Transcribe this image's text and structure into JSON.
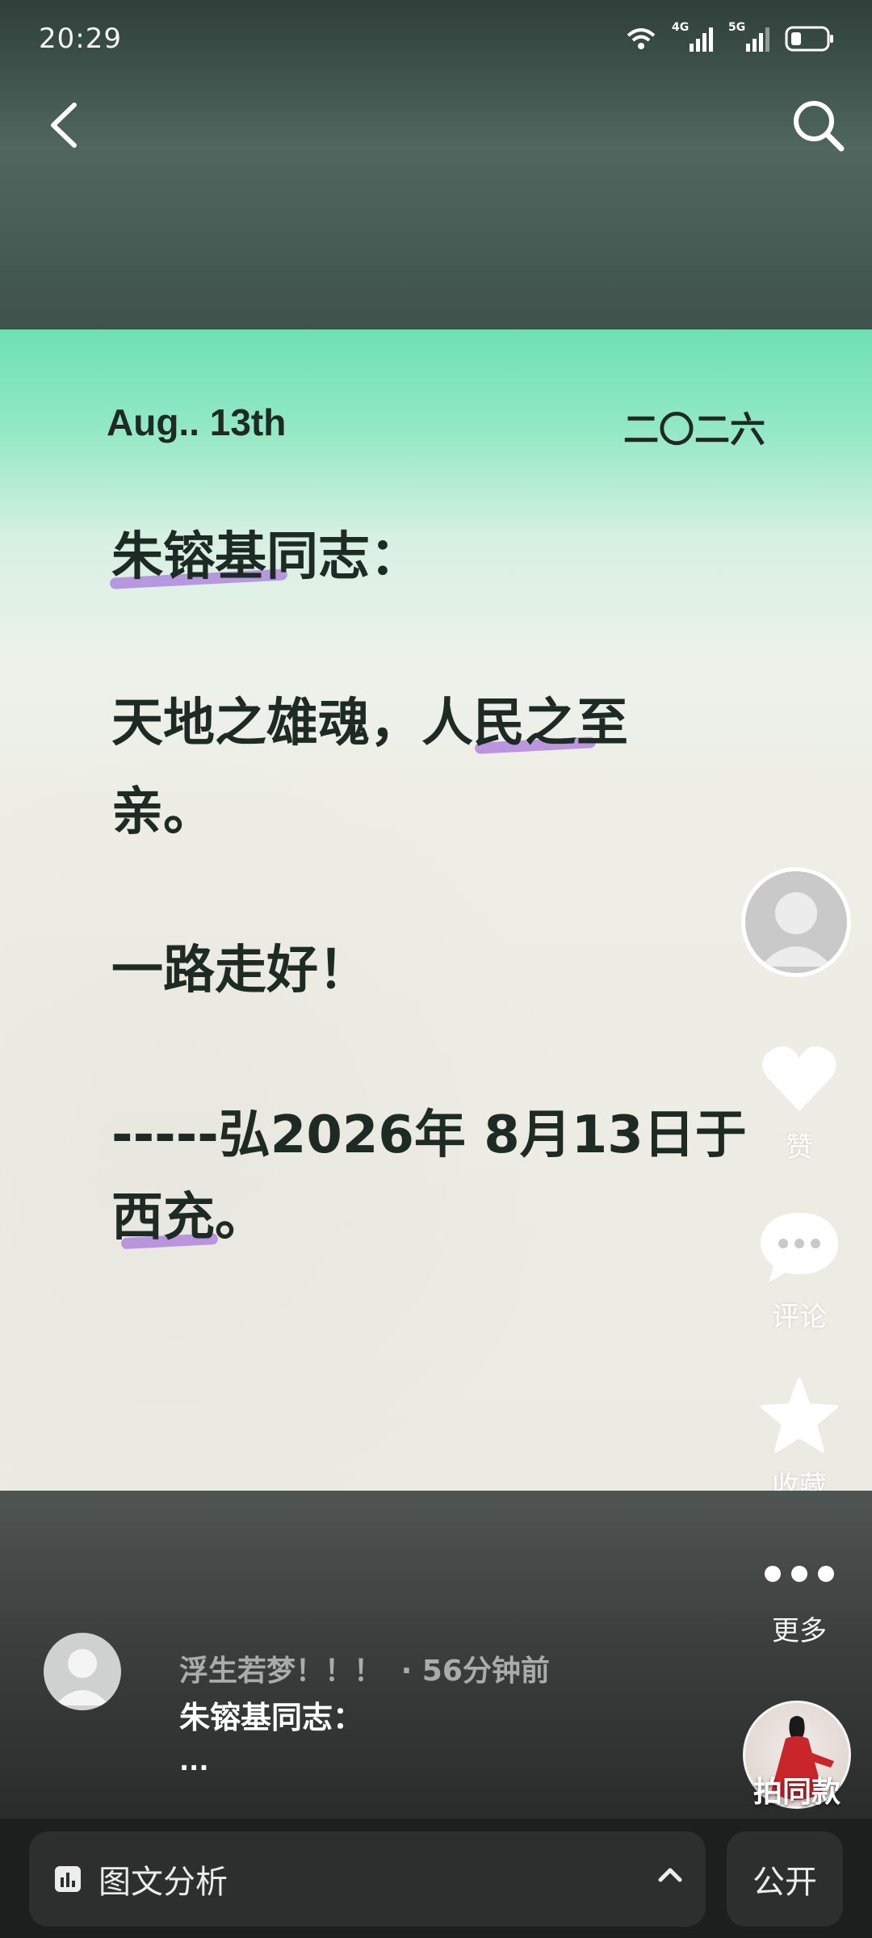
{
  "status_bar": {
    "time": "20:29",
    "network_1": "4G",
    "network_2": "5G",
    "icons": [
      "wifi-icon",
      "signal-4g-icon",
      "signal-5g-icon",
      "battery-icon"
    ]
  },
  "header": {
    "back_icon": "chevron-left-icon",
    "search_icon": "search-icon"
  },
  "note": {
    "date_left": "Aug.. 13th",
    "date_right": "二〇二六",
    "greeting": "朱镕基同志：",
    "line_1": "天地之雄魂，人民之至",
    "line_2": "亲。",
    "line_3": "一路走好！",
    "line_4": "-----弘2026年 8月13日于",
    "line_5": "西充。",
    "accent_color": "#a878dc"
  },
  "side_actions": {
    "like_label": "赞",
    "comment_label": "评论",
    "favorite_label": "收藏",
    "more_label": "更多"
  },
  "post": {
    "author": "浮生若梦！！！",
    "time_ago": "· 56分钟前",
    "title": "朱镕基同志：",
    "ellipsis": "...",
    "same_style_label": "拍同款"
  },
  "bottom_bar": {
    "analysis_label": "图文分析",
    "public_label": "公开"
  }
}
